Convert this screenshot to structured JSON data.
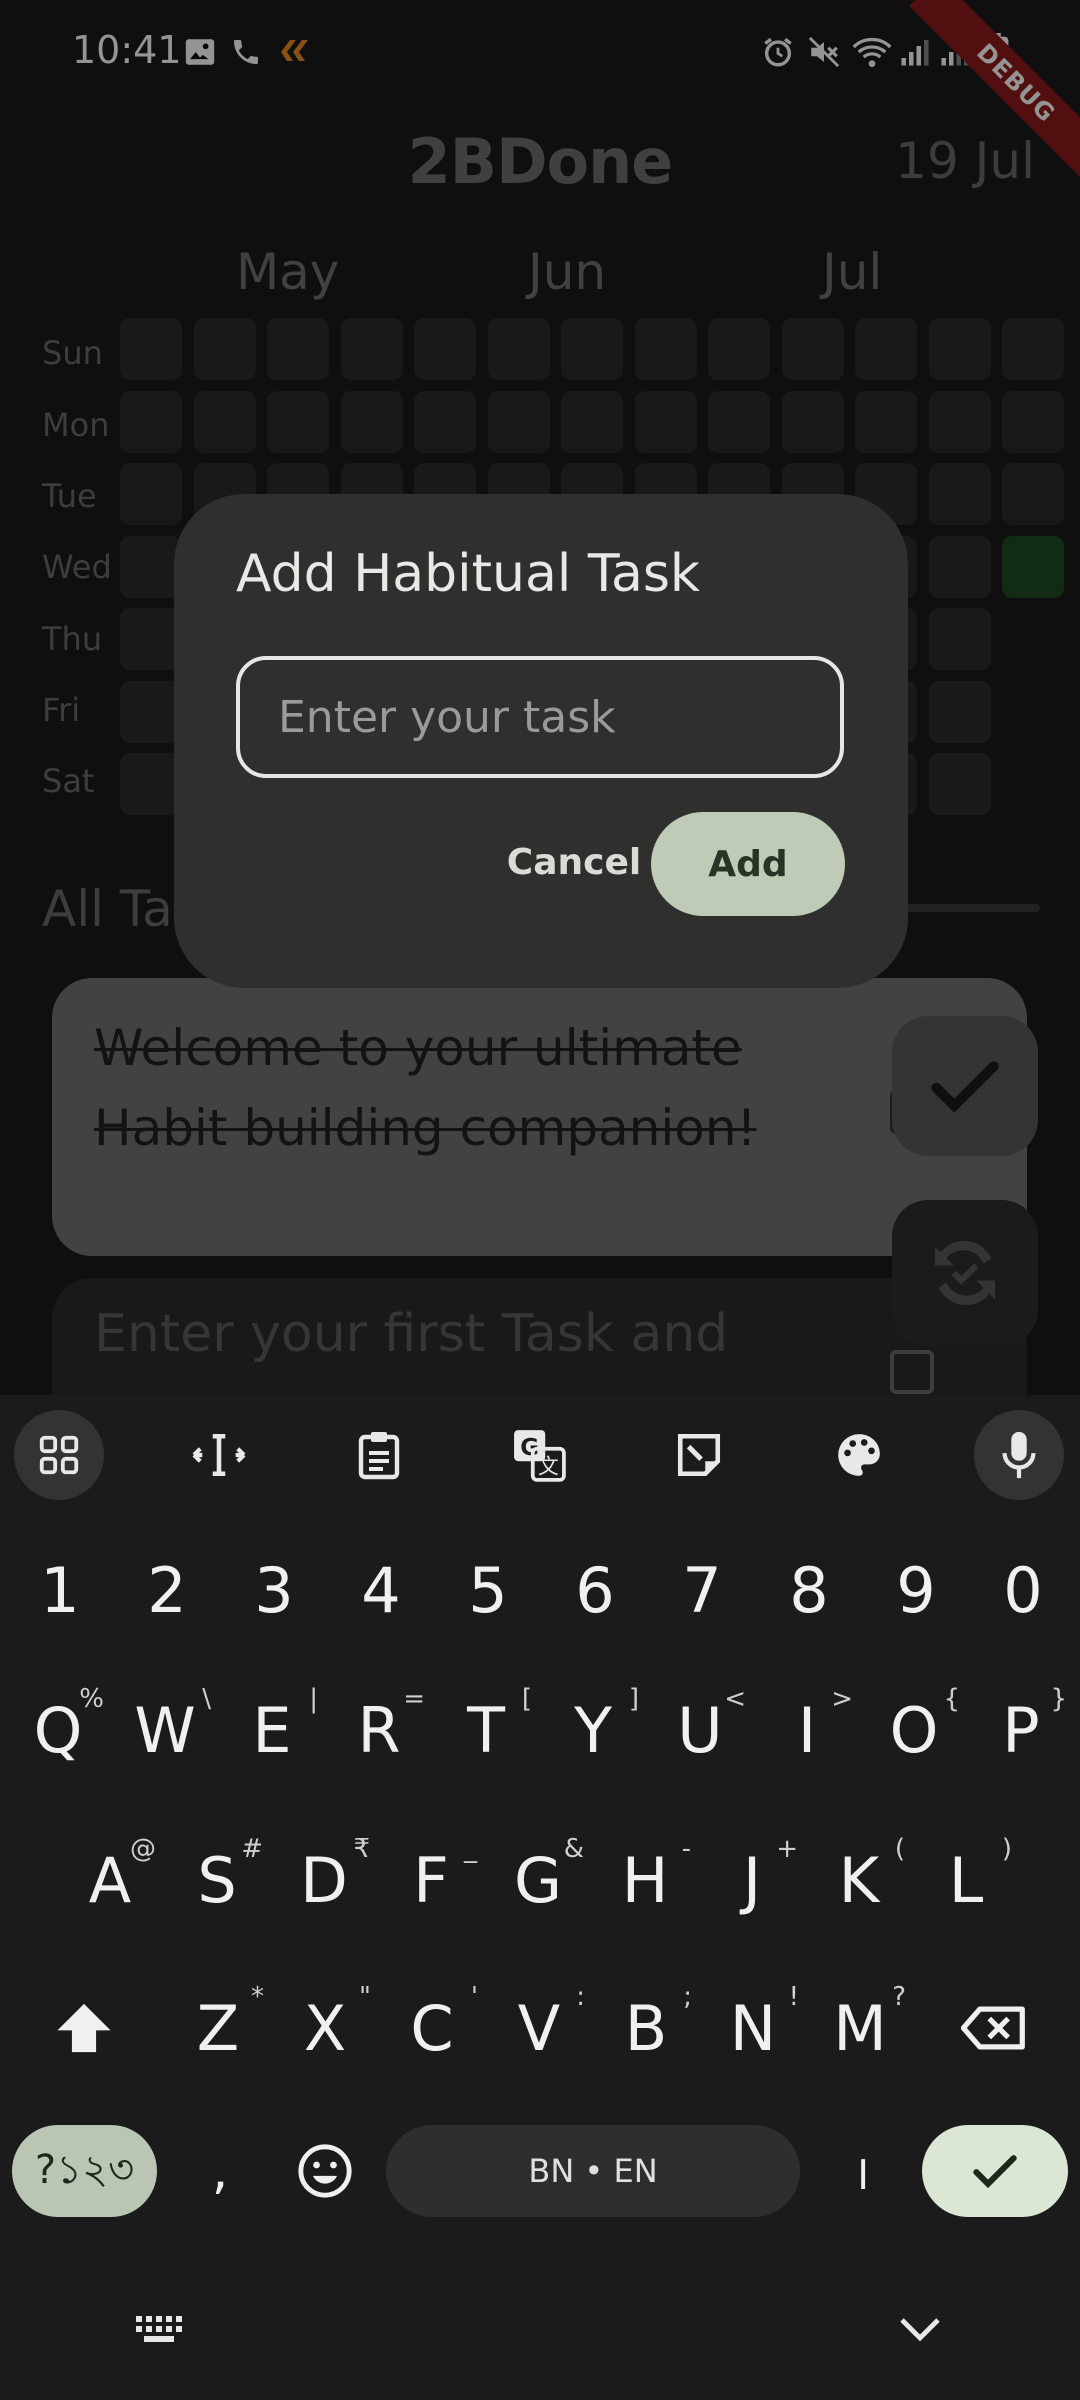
{
  "status_bar": {
    "time": "10:41",
    "left_icons": [
      "gallery-icon",
      "phone-icon",
      "app-notification-icon"
    ],
    "right_icons": [
      "alarm-icon",
      "mute-icon",
      "wifi-icon",
      "signal-icon",
      "signal-icon",
      "battery-icon"
    ]
  },
  "debug_banner": "DEBUG",
  "header": {
    "title": "2BDone",
    "date": "19 Jul"
  },
  "heatmap": {
    "months": [
      "May",
      "Jun",
      "Jul"
    ],
    "days": [
      "Sun",
      "Mon",
      "Tue",
      "Wed",
      "Thu",
      "Fri",
      "Sat"
    ],
    "active_color": "#1f4a22",
    "cell_color": "#2b2b2b"
  },
  "section": {
    "title": "All Tasks"
  },
  "tasks": [
    {
      "text": "Welcome to your ultimate Habit building companion!",
      "completed": true
    },
    {
      "text": "Enter your first Task and",
      "completed": false
    }
  ],
  "dialog": {
    "title": "Add Habitual Task",
    "input_placeholder": "Enter your task",
    "input_value": "",
    "cancel_label": "Cancel",
    "add_label": "Add"
  },
  "keyboard": {
    "toolbar_icons": [
      "apps-grid-icon",
      "cursor-control-icon",
      "clipboard-icon",
      "translate-icon",
      "sticker-icon",
      "palette-icon",
      "mic-icon"
    ],
    "number_row": [
      "1",
      "2",
      "3",
      "4",
      "5",
      "6",
      "7",
      "8",
      "9",
      "0"
    ],
    "row1": [
      {
        "k": "Q",
        "h": "%"
      },
      {
        "k": "W",
        "h": "\\"
      },
      {
        "k": "E",
        "h": "|"
      },
      {
        "k": "R",
        "h": "="
      },
      {
        "k": "T",
        "h": "["
      },
      {
        "k": "Y",
        "h": "]"
      },
      {
        "k": "U",
        "h": "<"
      },
      {
        "k": "I",
        "h": ">"
      },
      {
        "k": "O",
        "h": "{"
      },
      {
        "k": "P",
        "h": "}"
      }
    ],
    "row2": [
      {
        "k": "A",
        "h": "@"
      },
      {
        "k": "S",
        "h": "#"
      },
      {
        "k": "D",
        "h": "₹"
      },
      {
        "k": "F",
        "h": "_"
      },
      {
        "k": "G",
        "h": "&"
      },
      {
        "k": "H",
        "h": "-"
      },
      {
        "k": "J",
        "h": "+"
      },
      {
        "k": "K",
        "h": "("
      },
      {
        "k": "L",
        "h": ")"
      }
    ],
    "row3": [
      {
        "k": "Z",
        "h": "*"
      },
      {
        "k": "X",
        "h": "\""
      },
      {
        "k": "C",
        "h": "'"
      },
      {
        "k": "V",
        "h": ":"
      },
      {
        "k": "B",
        "h": ";"
      },
      {
        "k": "N",
        "h": "!"
      },
      {
        "k": "M",
        "h": "?"
      }
    ],
    "symbols_label": "?১২৩",
    "comma": ",",
    "space_label": "BN • EN",
    "bengali_danda": "।",
    "nav_icons": [
      "keyboard-switch-icon",
      "hide-keyboard-icon"
    ]
  }
}
